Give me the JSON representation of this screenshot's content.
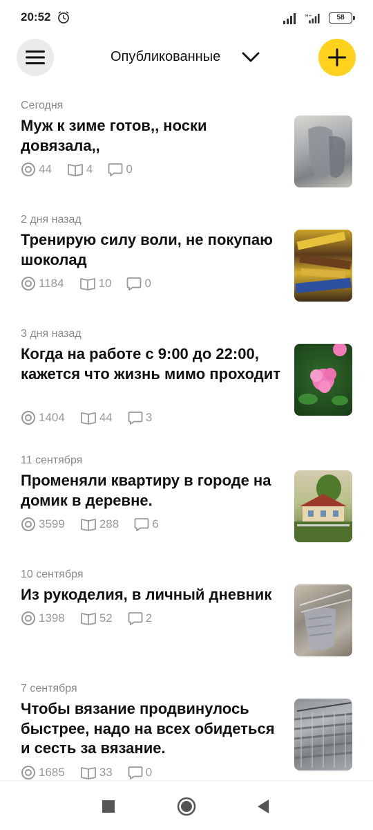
{
  "status_bar": {
    "time": "20:52",
    "battery": "58",
    "icons": [
      "alarm-icon",
      "signal-icon",
      "signal-hplus-icon",
      "battery-icon"
    ]
  },
  "header": {
    "title": "Опубликованные",
    "menu_icon": "hamburger-icon",
    "dropdown_icon": "chevron-down-icon",
    "add_icon": "plus-icon",
    "accent_color": "#ffd21e"
  },
  "posts": [
    {
      "date": "Сегодня",
      "title": "Муж к зиме готов,, носки довязала,,",
      "views": "44",
      "reads": "4",
      "comments": "0",
      "thumbnail": "knitted-socks-photo"
    },
    {
      "date": "2 дня назад",
      "title": "Тренирую силу воли, не покупаю шоколад",
      "views": "1184",
      "reads": "10",
      "comments": "0",
      "thumbnail": "chocolate-bars-photo"
    },
    {
      "date": "3 дня назад",
      "title": "Когда на работе с 9:00 до 22:00, кажется что жизнь мимо проходит",
      "views": "1404",
      "reads": "44",
      "comments": "3",
      "thumbnail": "pink-flowers-photo"
    },
    {
      "date": "11 сентября",
      "title": "Променяли квартиру в городе на домик в деревне.",
      "views": "3599",
      "reads": "288",
      "comments": "6",
      "thumbnail": "country-house-photo"
    },
    {
      "date": "10 сентября",
      "title": "Из рукоделия, в личный дневник",
      "views": "1398",
      "reads": "52",
      "comments": "2",
      "thumbnail": "knitting-needles-photo"
    },
    {
      "date": "7 сентября",
      "title": "Чтобы вязание продвинулось быстрее, надо на всех обидеться и сесть за вязание.",
      "views": "1685",
      "reads": "33",
      "comments": "0",
      "thumbnail": "grey-knitting-photo"
    }
  ],
  "stat_icons": [
    "views-icon",
    "reads-icon",
    "comments-icon"
  ],
  "nav_bar": {
    "icons": [
      "recents-icon",
      "home-icon",
      "back-icon"
    ]
  }
}
